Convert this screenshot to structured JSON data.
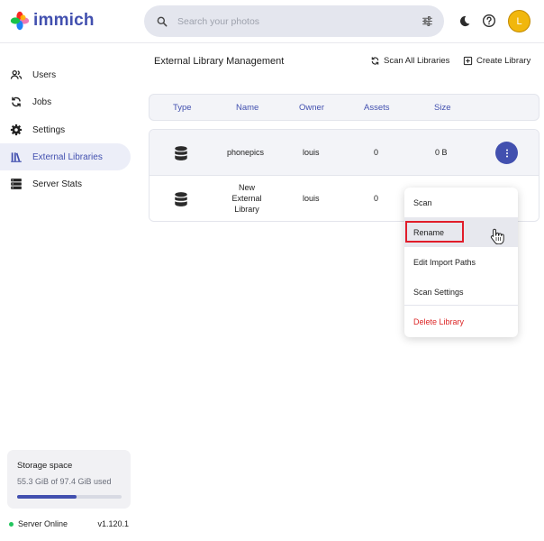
{
  "app": {
    "name": "immich"
  },
  "header": {
    "search_placeholder": "Search your photos",
    "avatar_initial": "L"
  },
  "sidebar": {
    "items": [
      {
        "label": "Users",
        "icon": "users-icon"
      },
      {
        "label": "Jobs",
        "icon": "sync-icon"
      },
      {
        "label": "Settings",
        "icon": "gear-icon"
      },
      {
        "label": "External Libraries",
        "icon": "library-icon",
        "active": true
      },
      {
        "label": "Server Stats",
        "icon": "server-icon"
      }
    ],
    "storage": {
      "title": "Storage space",
      "usage": "55.3 GiB of 97.4 GiB used",
      "used_fraction": 0.568
    },
    "server": {
      "status": "Server Online",
      "version": "v1.120.1"
    }
  },
  "main": {
    "title": "External Library Management",
    "actions": {
      "scan_all": "Scan All Libraries",
      "create": "Create Library"
    },
    "table": {
      "columns": [
        "Type",
        "Name",
        "Owner",
        "Assets",
        "Size"
      ],
      "rows": [
        {
          "name": "phonepics",
          "owner": "louis",
          "assets": "0",
          "size": "0 B"
        },
        {
          "name_lines": [
            "New",
            "External",
            "Library"
          ],
          "owner": "louis",
          "assets": "0"
        }
      ]
    },
    "context_menu": {
      "items": [
        "Scan",
        "Rename",
        "Edit Import Paths",
        "Scan Settings",
        "Delete Library"
      ],
      "hovered": "Rename"
    }
  },
  "colors": {
    "accent": "#4250af",
    "avatar": "#f1b70d",
    "danger": "#dc2626",
    "online": "#22c55e",
    "highlight_box": "#e11d2a"
  }
}
